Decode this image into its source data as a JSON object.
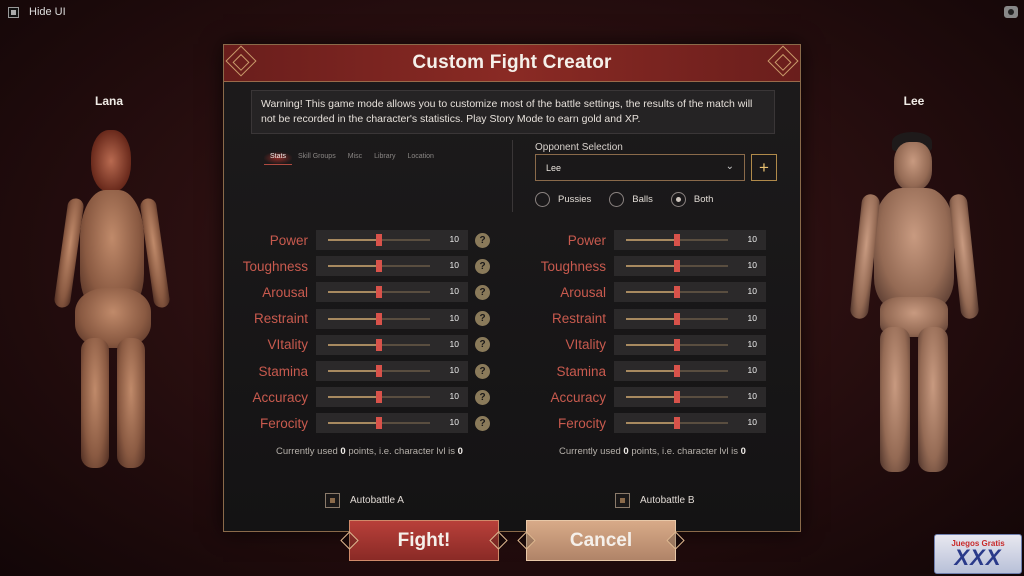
{
  "topbar": {
    "hide_ui_label": "Hide UI"
  },
  "characters": {
    "left_name": "Lana",
    "right_name": "Lee"
  },
  "panel": {
    "title": "Custom Fight Creator",
    "warning": "Warning! This game mode allows you to customize most of the battle settings, the results of the match will not be recorded in the character's statistics. Play Story Mode to earn gold and XP."
  },
  "tabs": [
    "Stats",
    "Skill Groups",
    "Misc",
    "Library",
    "Location"
  ],
  "active_tab": "Stats",
  "opponent": {
    "label": "Opponent Selection",
    "selected": "Lee",
    "add_symbol": "+",
    "options": [
      "Pussies",
      "Balls",
      "Both"
    ],
    "selected_option": "Both"
  },
  "stats_a": [
    {
      "label": "Power",
      "value": "10",
      "fraction": 0.5
    },
    {
      "label": "Toughness",
      "value": "10",
      "fraction": 0.5
    },
    {
      "label": "Arousal",
      "value": "10",
      "fraction": 0.5
    },
    {
      "label": "Restraint",
      "value": "10",
      "fraction": 0.5
    },
    {
      "label": "VItality",
      "value": "10",
      "fraction": 0.5
    },
    {
      "label": "Stamina",
      "value": "10",
      "fraction": 0.5
    },
    {
      "label": "Accuracy",
      "value": "10",
      "fraction": 0.5
    },
    {
      "label": "Ferocity",
      "value": "10",
      "fraction": 0.5
    }
  ],
  "stats_b": [
    {
      "label": "Power",
      "value": "10",
      "fraction": 0.5
    },
    {
      "label": "Toughness",
      "value": "10",
      "fraction": 0.5
    },
    {
      "label": "Arousal",
      "value": "10",
      "fraction": 0.5
    },
    {
      "label": "Restraint",
      "value": "10",
      "fraction": 0.5
    },
    {
      "label": "VItality",
      "value": "10",
      "fraction": 0.5
    },
    {
      "label": "Stamina",
      "value": "10",
      "fraction": 0.5
    },
    {
      "label": "Accuracy",
      "value": "10",
      "fraction": 0.5
    },
    {
      "label": "Ferocity",
      "value": "10",
      "fraction": 0.5
    }
  ],
  "help_symbol": "?",
  "points_a": {
    "prefix": "Currently used ",
    "points": "0",
    "middle": " points, i.e. character lvl is ",
    "level": "0"
  },
  "points_b": {
    "prefix": "Currently used ",
    "points": "0",
    "middle": " points, i.e. character lvl is ",
    "level": "0"
  },
  "autobattle_a": "Autobattle A",
  "autobattle_b": "Autobattle B",
  "buttons": {
    "fight": "Fight!",
    "cancel": "Cancel"
  },
  "watermark": {
    "big": "XXX",
    "small": "Juegos Gratis"
  },
  "colors": {
    "stat_label": "#c85a4e",
    "slider_thumb": "#d8524a",
    "fight_button": "#a8362f",
    "cancel_button": "#c89a78"
  }
}
